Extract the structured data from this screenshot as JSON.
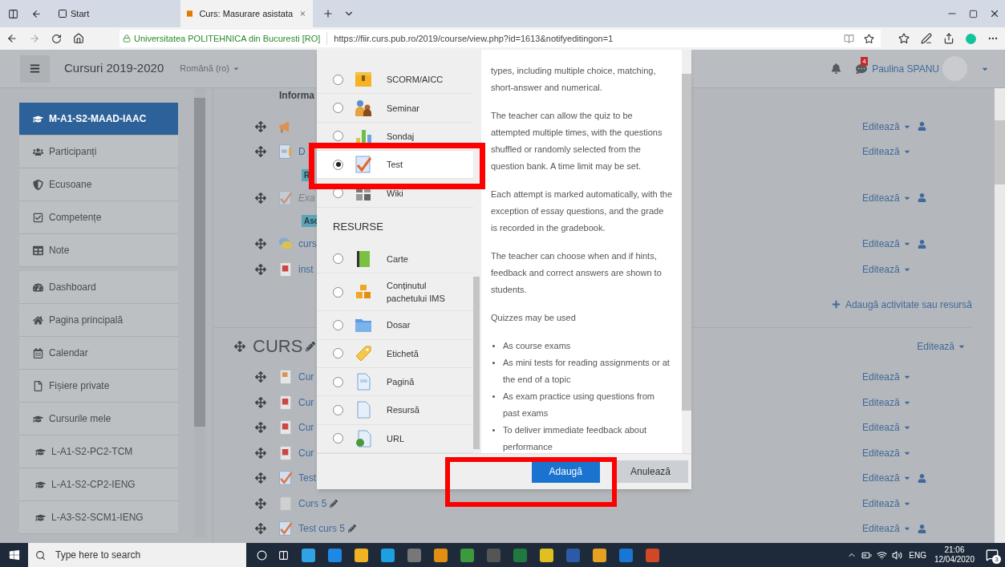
{
  "browser": {
    "tabs": [
      {
        "label": "Start",
        "selected": false
      },
      {
        "label": "Curs: Masurare asistata",
        "selected": true
      }
    ],
    "site_identity": "Universitatea POLITEHNICA din Bucuresti [RO]",
    "url": "https://fiir.curs.pub.ro/2019/course/view.php?id=1613&notifyeditingon=1"
  },
  "navbar": {
    "site_name": "Cursuri 2019-2020",
    "language": "Română (ro)",
    "message_count": "4",
    "user_name": "Paulina SPANU"
  },
  "sidebar": {
    "groups": [
      {
        "items": [
          {
            "label": "M-A1-S2-MAAD-IAAC",
            "kind": "course",
            "selected": true
          },
          {
            "label": "Participanți",
            "kind": "users",
            "selected": false
          },
          {
            "label": "Ecusoane",
            "kind": "badge",
            "selected": false
          },
          {
            "label": "Competențe",
            "kind": "competency",
            "selected": false
          },
          {
            "label": "Note",
            "kind": "grades",
            "selected": false
          }
        ]
      },
      {
        "items": [
          {
            "label": "Dashboard",
            "kind": "dashboard",
            "selected": false
          },
          {
            "label": "Pagina principală",
            "kind": "home",
            "selected": false
          },
          {
            "label": "Calendar",
            "kind": "calendar",
            "selected": false
          },
          {
            "label": "Fișiere private",
            "kind": "file",
            "selected": false
          },
          {
            "label": "Cursurile mele",
            "kind": "courses",
            "selected": false,
            "children": [
              {
                "label": "L-A1-S2-PC2-TCM",
                "kind": "course",
                "selected": false
              },
              {
                "label": "L-A1-S2-CP2-IENG",
                "kind": "course",
                "selected": false
              },
              {
                "label": "L-A3-S2-SCM1-IENG",
                "kind": "course",
                "selected": false
              }
            ]
          }
        ]
      }
    ]
  },
  "course": {
    "sections": [
      {
        "heading": "Informa",
        "kind": "general",
        "items": [
          {
            "kind": "activity",
            "edit_label": "Editează",
            "has_role": true
          },
          {
            "kind": "activity",
            "name": "D",
            "hidden": false,
            "name_pencil": false,
            "edit_label": "Editează",
            "has_role": false
          },
          {
            "kind": "restriction",
            "text": "R"
          },
          {
            "kind": "activity",
            "name": "Exa",
            "hidden": true,
            "name_pencil": false,
            "edit_label": "Editează",
            "has_role": true
          },
          {
            "kind": "restriction",
            "text": "Asc"
          },
          {
            "kind": "activity",
            "name": "curs",
            "hidden": false,
            "name_pencil": false,
            "edit_label": "Editează",
            "has_role": true
          },
          {
            "kind": "activity",
            "name": "inst",
            "hidden": false,
            "name_pencil": false,
            "edit_label": "Editează",
            "has_role": false
          }
        ],
        "add_link": "Adaugă activitate sau resursă"
      },
      {
        "heading": "CURS",
        "kind": "topic",
        "heading_pencil": true,
        "edit_label": "Editează",
        "items": [
          {
            "kind": "activity",
            "name": "Cur",
            "hidden": false,
            "name_pencil": false,
            "edit_label": "Editează",
            "has_role": false
          },
          {
            "kind": "activity",
            "name": "Cur",
            "hidden": false,
            "name_pencil": false,
            "edit_label": "Editează",
            "has_role": false
          },
          {
            "kind": "activity",
            "name": "Cur",
            "hidden": false,
            "name_pencil": false,
            "edit_label": "Editează",
            "has_role": false
          },
          {
            "kind": "activity",
            "name": "Cur",
            "hidden": false,
            "name_pencil": false,
            "edit_label": "Editează",
            "has_role": false
          },
          {
            "kind": "activity",
            "name": "Test",
            "hidden": false,
            "name_pencil": false,
            "edit_label": "Editează",
            "has_role": true
          },
          {
            "kind": "activity",
            "name": "Curs 5",
            "hidden": false,
            "name_pencil": true,
            "edit_label": "Editează",
            "has_role": false
          },
          {
            "kind": "activity",
            "name": "Test curs 5",
            "hidden": false,
            "name_pencil": true,
            "edit_label": "Editează",
            "has_role": true
          }
        ]
      }
    ]
  },
  "modal": {
    "activities": [
      {
        "label": "SCORM/AICC",
        "selected": false
      },
      {
        "label": "Seminar",
        "selected": false
      },
      {
        "label": "Sondaj",
        "selected": false
      },
      {
        "label": "Test",
        "selected": true
      },
      {
        "label": "Wiki",
        "selected": false
      }
    ],
    "resources": {
      "heading": "RESURSE",
      "options": [
        {
          "label": "Carte",
          "selected": false
        },
        {
          "label": "Conținutul pachetului IMS",
          "selected": false
        },
        {
          "label": "Dosar",
          "selected": false
        },
        {
          "label": "Etichetă",
          "selected": false
        },
        {
          "label": "Pagină",
          "selected": false
        },
        {
          "label": "Resursă",
          "selected": false
        },
        {
          "label": "URL",
          "selected": false
        }
      ]
    },
    "description": {
      "paragraphs": [
        "types, including multiple choice, matching, short-answer and numerical.",
        "The teacher can allow the quiz to be attempted multiple times, with the questions shuffled or randomly selected from the question bank. A time limit may be set.",
        "Each attempt is marked automatically, with the exception of essay questions, and the grade is recorded in the gradebook.",
        "The teacher can choose when and if hints, feedback and correct answers are shown to students.",
        "Quizzes may be used"
      ],
      "bullets": [
        "As course exams",
        "As mini tests for reading assignments or at the end of a topic",
        "As exam practice using questions from past exams",
        "To deliver immediate feedback about performance"
      ]
    },
    "buttons": [
      {
        "label": "Adaugă",
        "kind": "primary"
      },
      {
        "label": "Anulează",
        "kind": "secondary"
      }
    ]
  },
  "taskbar": {
    "search_placeholder": "Type here to search",
    "language": "ENG",
    "time": "21:06",
    "date": "12/04/2020",
    "notification_count": "3"
  }
}
